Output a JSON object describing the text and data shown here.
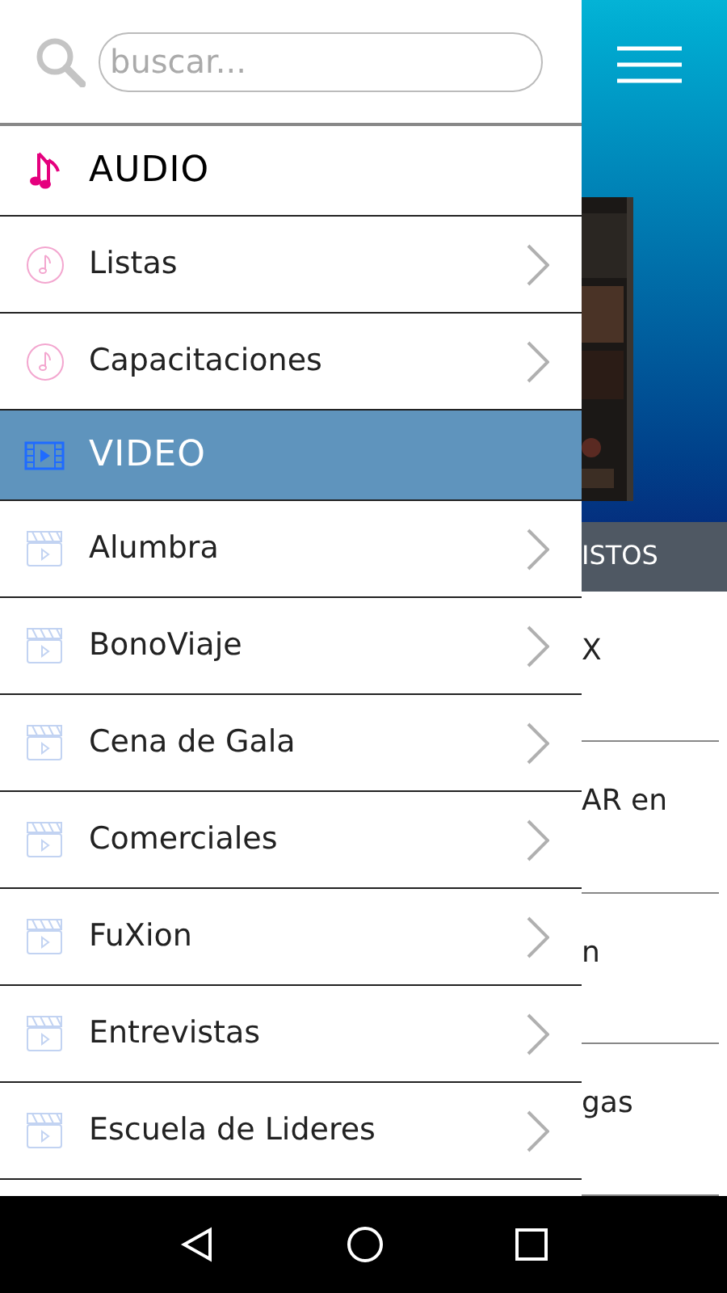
{
  "search": {
    "placeholder": "buscar..."
  },
  "sections": [
    {
      "kind": "audio",
      "title": "AUDIO",
      "selected": false,
      "items": [
        "Listas",
        "Capacitaciones"
      ]
    },
    {
      "kind": "video",
      "title": "VIDEO",
      "selected": true,
      "items": [
        "Alumbra",
        "BonoViaje",
        "Cena de Gala",
        "Comerciales",
        "FuXion",
        "Entrevistas",
        "Escuela de Lideres"
      ]
    }
  ],
  "background": {
    "tab": "ISTOS",
    "list": [
      "X",
      "AR en",
      "n",
      "gas"
    ]
  }
}
